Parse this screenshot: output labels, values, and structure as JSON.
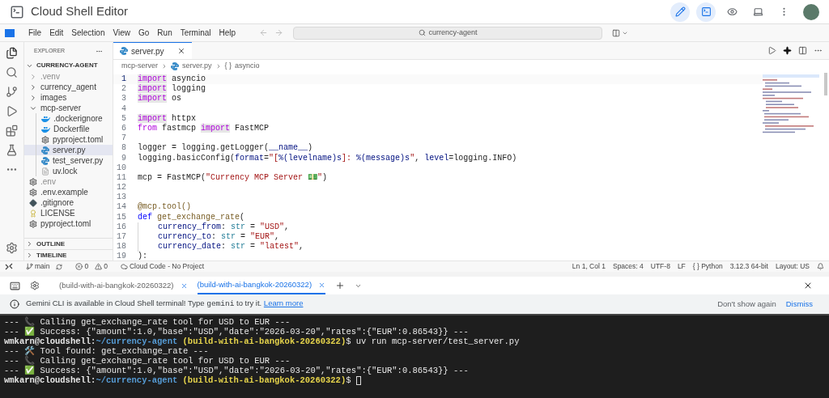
{
  "app_title": "Cloud Shell Editor",
  "header_buttons": [
    {
      "kind": "pencil",
      "selected": true
    },
    {
      "kind": "terminal",
      "selected": true
    },
    {
      "kind": "eye",
      "selected": false
    },
    {
      "kind": "laptop",
      "selected": false
    },
    {
      "kind": "more",
      "selected": false
    }
  ],
  "menu": [
    "File",
    "Edit",
    "Selection",
    "View",
    "Go",
    "Run",
    "Terminal",
    "Help"
  ],
  "command_center": {
    "value": "currency-agent"
  },
  "explorer": {
    "title": "EXPLORER",
    "root": "CURRENCY-AGENT",
    "items": [
      {
        "label": ".venv",
        "kind": "folder",
        "expanded": false,
        "dimmed": true,
        "selected": false
      },
      {
        "label": "currency_agent",
        "kind": "folder",
        "expanded": false,
        "dimmed": false,
        "selected": false
      },
      {
        "label": "images",
        "kind": "folder",
        "expanded": false,
        "dimmed": false,
        "selected": false
      },
      {
        "label": "mcp-server",
        "kind": "folder",
        "expanded": true,
        "dimmed": false,
        "selected": false,
        "children": [
          {
            "label": ".dockerignore",
            "kind": "docker",
            "dimmed": false,
            "selected": false
          },
          {
            "label": "Dockerfile",
            "kind": "docker",
            "dimmed": false,
            "selected": false
          },
          {
            "label": "pyproject.toml",
            "kind": "gear",
            "dimmed": false,
            "selected": false
          },
          {
            "label": "server.py",
            "kind": "python",
            "dimmed": false,
            "selected": true
          },
          {
            "label": "test_server.py",
            "kind": "python",
            "dimmed": false,
            "selected": false
          },
          {
            "label": "uv.lock",
            "kind": "text",
            "dimmed": false,
            "selected": false
          }
        ]
      },
      {
        "label": ".env",
        "kind": "gear",
        "dimmed": true,
        "selected": false
      },
      {
        "label": ".env.example",
        "kind": "gear",
        "dimmed": false,
        "selected": false
      },
      {
        "label": ".gitignore",
        "kind": "git",
        "dimmed": false,
        "selected": false
      },
      {
        "label": "LICENSE",
        "kind": "license",
        "dimmed": false,
        "selected": false
      },
      {
        "label": "pyproject.toml",
        "kind": "gear",
        "dimmed": false,
        "selected": false
      }
    ],
    "sections": [
      "OUTLINE",
      "TIMELINE"
    ]
  },
  "editor_tab": {
    "label": "server.py"
  },
  "breadcrumb": [
    "mcp-server",
    "server.py",
    "asyncio"
  ],
  "breadcrumb_symbol": "{ }",
  "code": [
    {
      "n": "1",
      "current": true,
      "tokens": [
        {
          "t": "import",
          "kind": "keyword",
          "highlighted": true
        },
        {
          "t": " asyncio",
          "kind": "plain",
          "highlighted": false
        }
      ]
    },
    {
      "n": "2",
      "current": false,
      "tokens": [
        {
          "t": "import",
          "kind": "keyword",
          "highlighted": true
        },
        {
          "t": " logging",
          "kind": "plain",
          "highlighted": false
        }
      ]
    },
    {
      "n": "3",
      "current": false,
      "tokens": [
        {
          "t": "import",
          "kind": "keyword",
          "highlighted": true
        },
        {
          "t": " os",
          "kind": "plain",
          "highlighted": false
        }
      ]
    },
    {
      "n": "4",
      "current": false
    },
    {
      "n": "5",
      "current": false,
      "tokens": [
        {
          "t": "import",
          "kind": "keyword",
          "highlighted": true
        },
        {
          "t": " httpx",
          "kind": "plain",
          "highlighted": false
        }
      ]
    },
    {
      "n": "6",
      "current": false,
      "tokens": [
        {
          "t": "from",
          "kind": "keyword",
          "highlighted": false
        },
        {
          "t": " fastmcp ",
          "kind": "plain",
          "highlighted": false
        },
        {
          "t": "import",
          "kind": "keyword",
          "highlighted": true
        },
        {
          "t": " FastMCP",
          "kind": "plain",
          "highlighted": false
        }
      ]
    },
    {
      "n": "7",
      "current": false
    },
    {
      "n": "8",
      "current": false,
      "tokens": [
        {
          "t": "logger = logging.getLogger(",
          "kind": "plain",
          "highlighted": false
        },
        {
          "t": "__name__",
          "kind": "variable",
          "highlighted": false
        },
        {
          "t": ")",
          "kind": "plain",
          "highlighted": false
        }
      ]
    },
    {
      "n": "9",
      "current": false,
      "tokens": [
        {
          "t": "logging.basicConfig(",
          "kind": "plain",
          "highlighted": false
        },
        {
          "t": "format",
          "kind": "variable",
          "highlighted": false
        },
        {
          "t": "=",
          "kind": "plain",
          "highlighted": false
        },
        {
          "t": "\"[",
          "kind": "string",
          "highlighted": false
        },
        {
          "t": "%(levelname)s",
          "kind": "variable",
          "highlighted": false
        },
        {
          "t": "]: ",
          "kind": "string",
          "highlighted": false
        },
        {
          "t": "%(message)s",
          "kind": "variable",
          "highlighted": false
        },
        {
          "t": "\"",
          "kind": "string",
          "highlighted": false
        },
        {
          "t": ", ",
          "kind": "plain",
          "highlighted": false
        },
        {
          "t": "level",
          "kind": "variable",
          "highlighted": false
        },
        {
          "t": "=logging.INFO)",
          "kind": "plain",
          "highlighted": false
        }
      ]
    },
    {
      "n": "10",
      "current": false
    },
    {
      "n": "11",
      "current": false,
      "tokens": [
        {
          "t": "mcp = FastMCP(",
          "kind": "plain",
          "highlighted": false
        },
        {
          "t": "\"Currency MCP Server 💵\"",
          "kind": "string",
          "highlighted": false
        },
        {
          "t": ")",
          "kind": "plain",
          "highlighted": false
        }
      ]
    },
    {
      "n": "12",
      "current": false
    },
    {
      "n": "13",
      "current": false
    },
    {
      "n": "14",
      "current": false,
      "tokens": [
        {
          "t": "@mcp.tool()",
          "kind": "function",
          "highlighted": false
        }
      ]
    },
    {
      "n": "15",
      "current": false,
      "tokens": [
        {
          "t": "def",
          "kind": "def",
          "highlighted": false
        },
        {
          "t": " get_exchange_rate",
          "kind": "function",
          "highlighted": false
        },
        {
          "t": "(",
          "kind": "plain",
          "highlighted": false
        }
      ]
    },
    {
      "n": "16",
      "current": false,
      "indented": true,
      "tokens": [
        {
          "t": "currency_from",
          "kind": "variable",
          "highlighted": false
        },
        {
          "t": ": ",
          "kind": "plain",
          "highlighted": false
        },
        {
          "t": "str",
          "kind": "type",
          "highlighted": false
        },
        {
          "t": " = ",
          "kind": "plain",
          "highlighted": false
        },
        {
          "t": "\"USD\"",
          "kind": "string",
          "highlighted": false
        },
        {
          "t": ",",
          "kind": "plain",
          "highlighted": false
        }
      ]
    },
    {
      "n": "17",
      "current": false,
      "indented": true,
      "tokens": [
        {
          "t": "currency_to",
          "kind": "variable",
          "highlighted": false
        },
        {
          "t": ": ",
          "kind": "plain",
          "highlighted": false
        },
        {
          "t": "str",
          "kind": "type",
          "highlighted": false
        },
        {
          "t": " = ",
          "kind": "plain",
          "highlighted": false
        },
        {
          "t": "\"EUR\"",
          "kind": "string",
          "highlighted": false
        },
        {
          "t": ",",
          "kind": "plain",
          "highlighted": false
        }
      ]
    },
    {
      "n": "18",
      "current": false,
      "indented": true,
      "tokens": [
        {
          "t": "currency_date",
          "kind": "variable",
          "highlighted": false
        },
        {
          "t": ": ",
          "kind": "plain",
          "highlighted": false
        },
        {
          "t": "str",
          "kind": "type",
          "highlighted": false
        },
        {
          "t": " = ",
          "kind": "plain",
          "highlighted": false
        },
        {
          "t": "\"latest\"",
          "kind": "string",
          "highlighted": false
        },
        {
          "t": ",",
          "kind": "plain",
          "highlighted": false
        }
      ]
    },
    {
      "n": "19",
      "current": false,
      "tokens": [
        {
          "t": "):",
          "kind": "plain",
          "highlighted": false
        }
      ]
    }
  ],
  "status_left": [
    {
      "kind": "remote"
    },
    {
      "kind": "branch",
      "text": "main"
    },
    {
      "kind": "sync"
    },
    {
      "kind": "errors",
      "text": "0"
    },
    {
      "kind": "warnings",
      "text": "0"
    },
    {
      "kind": "cloud",
      "text": "Cloud Code - No Project"
    }
  ],
  "status_right": [
    "Ln 1, Col 1",
    "Spaces: 4",
    "UTF-8",
    "LF",
    "{ } Python",
    "3.12.3 64-bit",
    "Layout: US"
  ],
  "terminal_tabs": [
    {
      "label": "(build-with-ai-bangkok-20260322)",
      "selected": false
    },
    {
      "label": "(build-with-ai-bangkok-20260322)",
      "selected": true
    }
  ],
  "banner": {
    "before": "Gemini CLI is available in Cloud Shell terminal! Type ",
    "code": "gemini",
    "after": " to try it.",
    "link": "Learn more",
    "actions": [
      "Don't show again",
      "Dismiss"
    ]
  },
  "terminal": [
    {
      "kind": "output",
      "text": "--- 📞 Calling get_exchange_rate tool for USD to EUR ---"
    },
    {
      "kind": "output",
      "text": "--- ✅ Success: {\"amount\":1.0,\"base\":\"USD\",\"date\":\"2026-03-20\",\"rates\":{\"EUR\":0.86543}} ---"
    },
    {
      "kind": "prompt",
      "user": "wmkarn@cloudshell:",
      "path": "~/currency-agent",
      "project": "(build-with-ai-bangkok-20260322)",
      "command": "$ uv run mcp-server/test_server.py"
    },
    {
      "kind": "output",
      "text": "--- 🛠️ Tool found: get_exchange_rate ---"
    },
    {
      "kind": "output",
      "text": "--- 📞 Calling get_exchange_rate tool for USD to EUR ---"
    },
    {
      "kind": "output",
      "text": "--- ✅ Success: {\"amount\":1.0,\"base\":\"USD\",\"date\":\"2026-03-20\",\"rates\":{\"EUR\":0.86543}} ---"
    },
    {
      "kind": "prompt",
      "user": "wmkarn@cloudshell:",
      "path": "~/currency-agent",
      "project": "(build-with-ai-bangkok-20260322)",
      "command": "$",
      "cursor": true
    }
  ]
}
